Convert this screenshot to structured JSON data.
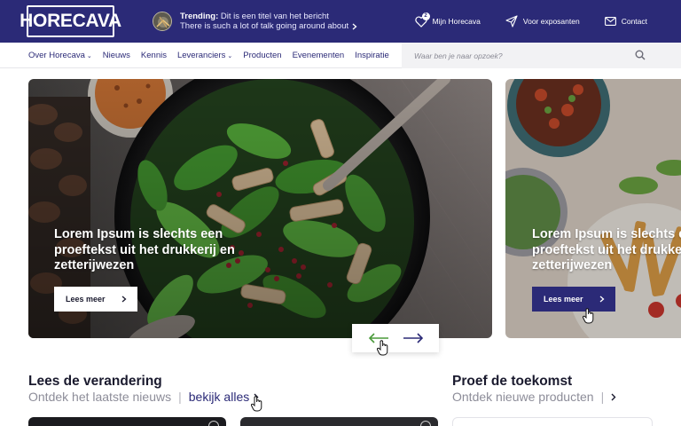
{
  "header": {
    "logo": "HORECAVA",
    "trending_label": "Trending:",
    "trending_title": "Dit is een titel van het bericht",
    "trending_text": "There is such a lot of talk going around about",
    "links": [
      {
        "label": "Mijn Horecava",
        "icon": "heart-icon",
        "badge": "2"
      },
      {
        "label": "Voor exposanten",
        "icon": "send-icon"
      },
      {
        "label": "Contact",
        "icon": "mail-icon"
      }
    ]
  },
  "nav": {
    "items": [
      {
        "label": "Over Horecava",
        "dropdown": true
      },
      {
        "label": "Nieuws",
        "dropdown": false
      },
      {
        "label": "Kennis",
        "dropdown": false
      },
      {
        "label": "Leveranciers",
        "dropdown": true
      },
      {
        "label": "Producten",
        "dropdown": false
      },
      {
        "label": "Evenementen",
        "dropdown": false
      },
      {
        "label": "Inspiratie",
        "dropdown": false
      }
    ],
    "search_placeholder": "Waar ben je naar opzoek?"
  },
  "hero": {
    "slides": [
      {
        "text": "Lorem Ipsum is slechts een proeftekst uit het drukkerij en zetterijwezen",
        "button": "Lees meer"
      },
      {
        "text": "Lorem Ipsum is slechts een proeftekst uit het drukkerij en zetterijwezen",
        "button": "Lees meer"
      }
    ]
  },
  "sections": {
    "news": {
      "title": "Lees de verandering",
      "subtitle": "Ontdek het laatste nieuws",
      "link": "bekijk alles"
    },
    "future": {
      "title": "Proef de toekomst",
      "subtitle": "Ontdek nieuwe producten"
    }
  },
  "colors": {
    "brand": "#2b2a77",
    "accent_green": "#4a9a3a"
  }
}
